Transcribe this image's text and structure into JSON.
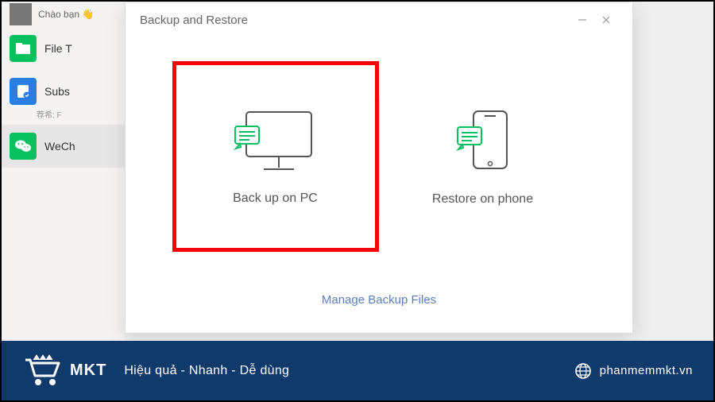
{
  "sidebar": {
    "greeting": "Chào bạn 👋",
    "items": [
      {
        "label": "File T",
        "icon": "folder-icon",
        "color": "green"
      },
      {
        "label": "Subs",
        "sub": "荐希: F",
        "icon": "clipboard-check-icon",
        "color": "blue"
      },
      {
        "label": "WeCh",
        "icon": "wechat-icon",
        "color": "wechat",
        "selected": true
      }
    ]
  },
  "dialog": {
    "title": "Backup and Restore",
    "option_backup": "Back up on PC",
    "option_restore": "Restore on phone",
    "manage_link": "Manage Backup Files"
  },
  "bottombar": {
    "brand": "MKT",
    "slogan": "Hiệu quả - Nhanh - Dễ dùng",
    "site": "phanmemmkt.vn"
  },
  "colors": {
    "highlight": "#ff0000",
    "brandbar": "#103a6b",
    "green": "#07c160",
    "blue": "#2a7de1"
  }
}
